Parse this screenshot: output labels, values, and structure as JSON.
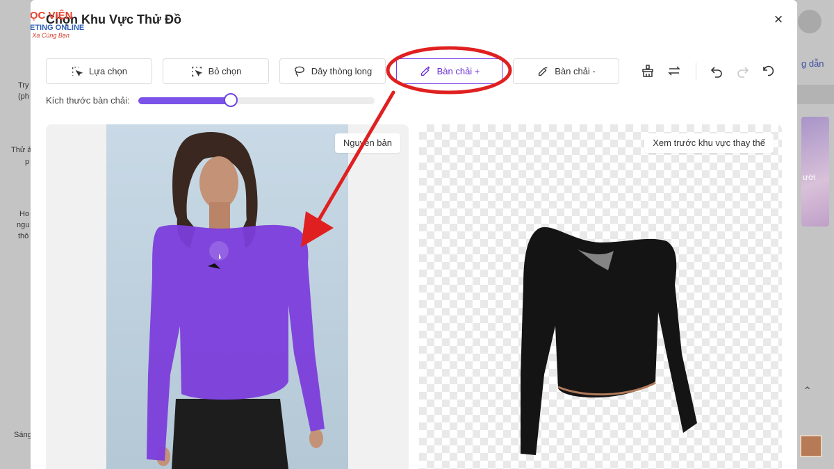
{
  "modal": {
    "title": "Chọn Khu Vực Thử Đồ",
    "close_label": "×"
  },
  "logo": {
    "line1": "HỌC VIỆN",
    "line2": "MARKETING ONLINE",
    "line3": "Viện Xa Cùng Bạn"
  },
  "toolbar": {
    "tools": [
      {
        "label": "Lựa chọn",
        "icon": "select-sparkle-icon",
        "active": false
      },
      {
        "label": "Bỏ chọn",
        "icon": "deselect-icon",
        "active": false
      },
      {
        "label": "Dây thòng long",
        "icon": "lasso-icon",
        "active": false
      },
      {
        "label": "Bàn chải +",
        "icon": "brush-plus-icon",
        "active": true
      },
      {
        "label": "Bàn chải -",
        "icon": "brush-minus-icon",
        "active": false
      }
    ],
    "actions": [
      "clear-icon",
      "swap-icon",
      "undo-icon",
      "redo-icon",
      "reset-icon"
    ]
  },
  "brush": {
    "label": "Kích thước bàn chải:",
    "value": 0.39
  },
  "panels": {
    "original_label": "Nguyên bản",
    "preview_label": "Xem trước khu vực thay thế"
  },
  "background": {
    "left_texts": [
      "Try",
      "(ph",
      "Thử ả",
      "p",
      "Ho",
      "ngu",
      "thô",
      "Sáng"
    ],
    "right_texts": [
      "g dẫn",
      "ười"
    ]
  },
  "colors": {
    "accent": "#7b3fe4",
    "mask": "#7b3ddb",
    "annotation": "#e02020"
  }
}
